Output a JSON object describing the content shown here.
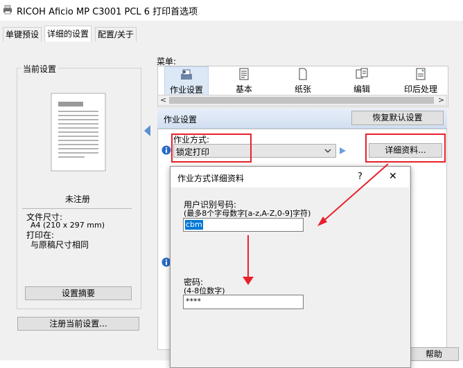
{
  "window": {
    "title": "RICOH Aficio MP C3001 PCL 6 打印首选项"
  },
  "tabs": [
    {
      "label": "单键预设"
    },
    {
      "label": "详细的设置"
    },
    {
      "label": "配置/关于"
    }
  ],
  "left_panel": {
    "current_settings_title": "当前设置",
    "unregistered": "未注册",
    "paper_size_label": "文件尺寸:",
    "paper_size_value": "A4 (210 x 297 mm)",
    "print_on_label": "打印在:",
    "print_on_value": "与原稿尺寸相同",
    "summary_button": "设置摘要",
    "register_button": "注册当前设置..."
  },
  "menu": {
    "label": "菜单:",
    "items": [
      {
        "label": "作业设置",
        "icon": "job-settings-icon"
      },
      {
        "label": "基本",
        "icon": "basic-icon"
      },
      {
        "label": "纸张",
        "icon": "paper-icon"
      },
      {
        "label": "编辑",
        "icon": "edit-icon"
      },
      {
        "label": "印后处理",
        "icon": "finishing-icon"
      }
    ]
  },
  "job_section": {
    "title": "作业设置",
    "reset_button": "恢复默认设置",
    "job_type_label": "作业方式:",
    "job_type_value": "锁定打印",
    "details_button": "详细资料..."
  },
  "dialog": {
    "title": "作业方式详细资料",
    "help_glyph": "?",
    "close_glyph": "✕",
    "user_id_label": "用户识别号码:",
    "user_id_hint": "(最多8个字母数字[a-z,A-Z,0-9]字符)",
    "user_id_value": "cbm",
    "password_label": "密码:",
    "password_hint": "(4-8位数字)",
    "password_value": "****"
  },
  "footer": {
    "help_button": "帮助"
  },
  "colors": {
    "accent": "#0078d7",
    "highlight_box": "#e8202a",
    "section_band": "#dbe6f4"
  }
}
